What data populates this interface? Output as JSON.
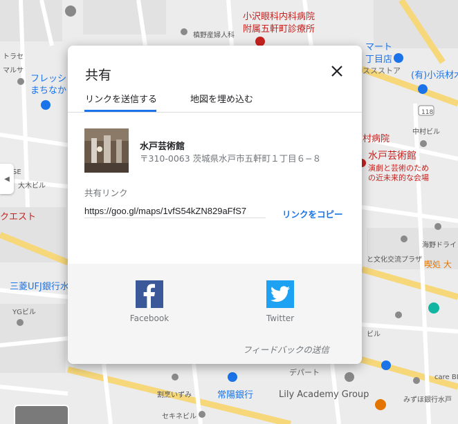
{
  "dialog": {
    "title": "共有",
    "tabs": [
      {
        "label": "リンクを送信する",
        "active": true
      },
      {
        "label": "地図を埋め込む",
        "active": false
      }
    ],
    "place": {
      "name": "水戸芸術館",
      "address": "〒310-0063 茨城県水戸市五軒町１丁目６−８"
    },
    "share_link_label": "共有リンク",
    "share_url": "https://goo.gl/maps/1vfS54kZN829aFfS7",
    "copy_label": "リンクをコピー",
    "social": [
      {
        "name": "Facebook",
        "icon": "facebook-icon",
        "color": "#3b5998"
      },
      {
        "name": "Twitter",
        "icon": "twitter-icon",
        "color": "#1da1f2"
      }
    ],
    "feedback_label": "フィードバックの送信"
  },
  "map": {
    "labels": {
      "hospital": "小沢眼科内科病院",
      "clinic": "附属五軒町診療所",
      "obgyn": "槙野産婦人科",
      "fresh1": "フレッシ",
      "fresh2": "まちなか",
      "mart": "マート",
      "chome": "丁目店",
      "store": "ススストア",
      "kohama": "(有)小浜材木",
      "route": "118",
      "nakamura": "中村ビル",
      "hospital2": "村病院",
      "arttower": "水戸芸術館",
      "arttower_desc1": "演劇と芸術のため",
      "arttower_desc2": "の近未来的な会場",
      "otsuki": "大木ビル",
      "quest": "クエスト",
      "mufg": "三菱UFJ銀行水",
      "yg": "YGビル",
      "unno": "海野ドライ",
      "culture": "と文化交流プラザ",
      "kissho": "喫処 大",
      "bldg": "ビル",
      "bank": "常陽銀行",
      "lily": "Lily Academy Group",
      "mizuho": "みずほ銀行水戸",
      "care": "care BI",
      "izumi": "割烹いずみ",
      "dept": "デパート",
      "sekine": "セキネビル",
      "torase": "トラセ",
      "marusa": "マルサ",
      "se": "SE"
    }
  }
}
